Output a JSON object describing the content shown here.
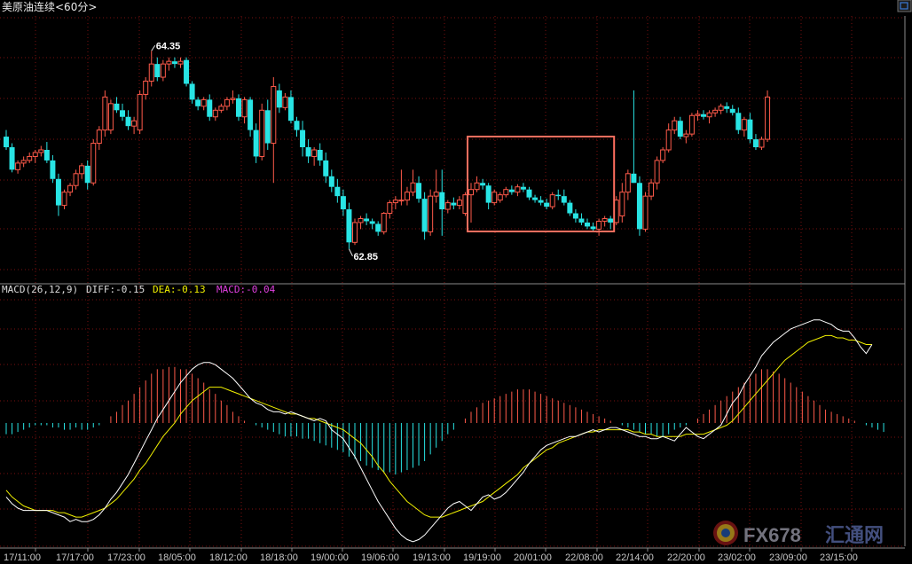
{
  "window": {
    "title": "美原油连续<60分>",
    "corner_icon": "window-restore-icon"
  },
  "colors": {
    "up": "#ff5a4a",
    "down": "#28e4e4",
    "grid": "#7a1010",
    "diff": "#ffffff",
    "dea": "#f0f000",
    "macd_label": "#e040e0",
    "highlight_box": "#ff6e5e",
    "axis_text": "#c8c8c8",
    "watermark": "#9a9aa8"
  },
  "indicator": {
    "name": "MACD(26,12,9)",
    "diff_label": "DIFF:-0.15",
    "dea_label": "DEA:-0.13",
    "macd_label": "MACD:-0.04"
  },
  "watermark": {
    "text": "FX678",
    "sub": "汇通网"
  },
  "chart_data": [
    {
      "type": "candlestick",
      "title": "美原油连续<60分>",
      "y_range": [
        62.6,
        64.6
      ],
      "annotations": [
        {
          "label": "64.35",
          "value": 64.35,
          "at_candle": 25
        },
        {
          "label": "62.85",
          "value": 62.85,
          "at_candle": 59
        }
      ],
      "highlight_box": {
        "from_candle": 80,
        "to_candle": 104
      },
      "x_tick_labels": [
        "17/11:00",
        "17/17:00",
        "17/23:00",
        "18/05:00",
        "18/12:00",
        "18/18:00",
        "19/00:00",
        "19/06:00",
        "19/13:00",
        "19/19:00",
        "20/01:00",
        "22/08:00",
        "22/14:00",
        "22/20:00",
        "23/02:00",
        "23/09:00",
        "23/15:00"
      ],
      "ohlc": [
        [
          63.7,
          63.75,
          63.6,
          63.62
        ],
        [
          63.62,
          63.65,
          63.43,
          63.45
        ],
        [
          63.45,
          63.52,
          63.42,
          63.5
        ],
        [
          63.5,
          63.55,
          63.47,
          63.52
        ],
        [
          63.52,
          63.58,
          63.5,
          63.55
        ],
        [
          63.55,
          63.6,
          63.5,
          63.58
        ],
        [
          63.58,
          63.63,
          63.55,
          63.6
        ],
        [
          63.6,
          63.66,
          63.5,
          63.52
        ],
        [
          63.52,
          63.56,
          63.35,
          63.38
        ],
        [
          63.38,
          63.42,
          63.1,
          63.18
        ],
        [
          63.18,
          63.3,
          63.15,
          63.28
        ],
        [
          63.28,
          63.35,
          63.25,
          63.33
        ],
        [
          63.33,
          63.45,
          63.3,
          63.42
        ],
        [
          63.42,
          63.5,
          63.38,
          63.48
        ],
        [
          63.48,
          63.52,
          63.3,
          63.35
        ],
        [
          63.35,
          63.68,
          63.33,
          63.65
        ],
        [
          63.65,
          63.78,
          63.6,
          63.75
        ],
        [
          63.75,
          64.05,
          63.7,
          64.0
        ],
        [
          63.75,
          63.98,
          63.72,
          63.95
        ],
        [
          63.95,
          64.0,
          63.88,
          63.9
        ],
        [
          63.9,
          63.95,
          63.82,
          63.85
        ],
        [
          63.85,
          63.9,
          63.75,
          63.78
        ],
        [
          63.78,
          63.85,
          63.72,
          63.82
        ],
        [
          63.75,
          64.05,
          63.72,
          64.02
        ],
        [
          64.02,
          64.15,
          63.98,
          64.12
        ],
        [
          64.12,
          64.35,
          64.08,
          64.25
        ],
        [
          64.25,
          64.3,
          64.12,
          64.15
        ],
        [
          64.15,
          64.28,
          64.12,
          64.25
        ],
        [
          64.25,
          64.3,
          64.2,
          64.27
        ],
        [
          64.27,
          64.3,
          64.22,
          64.25
        ],
        [
          64.25,
          64.3,
          64.22,
          64.27
        ],
        [
          64.28,
          64.3,
          64.08,
          64.1
        ],
        [
          64.1,
          64.12,
          63.95,
          63.98
        ],
        [
          63.98,
          64.0,
          63.9,
          63.93
        ],
        [
          63.93,
          64.0,
          63.9,
          63.98
        ],
        [
          63.98,
          64.02,
          63.82,
          63.85
        ],
        [
          63.85,
          63.92,
          63.82,
          63.9
        ],
        [
          63.9,
          63.95,
          63.88,
          63.93
        ],
        [
          63.93,
          64.0,
          63.9,
          63.98
        ],
        [
          63.98,
          64.05,
          63.95,
          63.99
        ],
        [
          63.99,
          64.02,
          63.82,
          63.85
        ],
        [
          63.85,
          64.0,
          63.8,
          63.98
        ],
        [
          63.98,
          64.0,
          63.7,
          63.75
        ],
        [
          63.75,
          63.8,
          63.5,
          63.55
        ],
        [
          63.55,
          63.95,
          63.52,
          63.9
        ],
        [
          63.9,
          63.98,
          63.6,
          63.65
        ],
        [
          63.65,
          64.15,
          63.35,
          64.08
        ],
        [
          64.05,
          64.1,
          63.88,
          63.92
        ],
        [
          63.92,
          64.03,
          63.9,
          64.0
        ],
        [
          64.0,
          64.05,
          63.8,
          63.82
        ],
        [
          63.82,
          63.85,
          63.7,
          63.75
        ],
        [
          63.75,
          63.82,
          63.55,
          63.62
        ],
        [
          63.62,
          63.68,
          63.5,
          63.55
        ],
        [
          63.55,
          63.62,
          63.48,
          63.6
        ],
        [
          63.6,
          63.65,
          63.48,
          63.52
        ],
        [
          63.52,
          63.58,
          63.35,
          63.4
        ],
        [
          63.4,
          63.45,
          63.28,
          63.32
        ],
        [
          63.32,
          63.38,
          63.2,
          63.25
        ],
        [
          63.25,
          63.3,
          63.1,
          63.15
        ],
        [
          63.15,
          63.2,
          62.85,
          62.9
        ],
        [
          62.9,
          63.08,
          62.88,
          63.05
        ],
        [
          63.05,
          63.1,
          63.0,
          63.08
        ],
        [
          63.08,
          63.12,
          63.03,
          63.06
        ],
        [
          63.06,
          63.08,
          63.0,
          63.04
        ],
        [
          63.04,
          63.06,
          62.95,
          62.98
        ],
        [
          62.98,
          63.13,
          62.96,
          63.12
        ],
        [
          63.12,
          63.22,
          63.08,
          63.2
        ],
        [
          63.2,
          63.25,
          63.15,
          63.22
        ],
        [
          63.22,
          63.45,
          63.18,
          63.22
        ],
        [
          63.22,
          63.32,
          63.18,
          63.28
        ],
        [
          63.28,
          63.45,
          63.25,
          63.35
        ],
        [
          63.35,
          63.4,
          63.2,
          63.23
        ],
        [
          63.23,
          63.28,
          62.92,
          62.98
        ],
        [
          62.98,
          63.3,
          62.95,
          63.25
        ],
        [
          63.25,
          63.45,
          63.2,
          63.28
        ],
        [
          63.28,
          63.45,
          62.95,
          63.15
        ],
        [
          63.15,
          63.22,
          63.12,
          63.2
        ],
        [
          63.2,
          63.24,
          63.15,
          63.18
        ],
        [
          63.18,
          63.25,
          63.15,
          63.22
        ],
        [
          63.12,
          63.28,
          63.1,
          63.26
        ],
        [
          63.26,
          63.35,
          63.05,
          63.3
        ],
        [
          63.3,
          63.4,
          63.28,
          63.35
        ],
        [
          63.35,
          63.38,
          63.3,
          63.33
        ],
        [
          63.33,
          63.35,
          63.15,
          63.2
        ],
        [
          63.2,
          63.3,
          63.18,
          63.28
        ],
        [
          63.22,
          63.28,
          63.2,
          63.26
        ],
        [
          63.26,
          63.32,
          63.24,
          63.3
        ],
        [
          63.3,
          63.33,
          63.26,
          63.28
        ],
        [
          63.28,
          63.34,
          63.25,
          63.32
        ],
        [
          63.32,
          63.35,
          63.28,
          63.3
        ],
        [
          63.3,
          63.32,
          63.22,
          63.24
        ],
        [
          63.24,
          63.26,
          63.2,
          63.22
        ],
        [
          63.22,
          63.25,
          63.18,
          63.2
        ],
        [
          63.2,
          63.23,
          63.15,
          63.17
        ],
        [
          63.17,
          63.28,
          63.15,
          63.26
        ],
        [
          63.26,
          63.3,
          63.22,
          63.25
        ],
        [
          63.25,
          63.3,
          63.18,
          63.2
        ],
        [
          63.2,
          63.22,
          63.1,
          63.12
        ],
        [
          63.12,
          63.15,
          63.05,
          63.08
        ],
        [
          63.08,
          63.12,
          63.03,
          63.05
        ],
        [
          63.05,
          63.08,
          63.0,
          63.02
        ],
        [
          63.02,
          63.05,
          62.98,
          63.0
        ],
        [
          63.0,
          63.08,
          62.95,
          63.06
        ],
        [
          63.06,
          63.1,
          63.02,
          63.08
        ],
        [
          63.08,
          63.1,
          63.0,
          63.05
        ],
        [
          63.05,
          63.25,
          63.03,
          63.22
        ],
        [
          63.1,
          63.35,
          63.05,
          63.28
        ],
        [
          63.28,
          63.45,
          63.22,
          63.42
        ],
        [
          63.42,
          64.05,
          63.35,
          63.35
        ],
        [
          63.35,
          63.4,
          62.95,
          63.0
        ],
        [
          63.0,
          63.28,
          62.98,
          63.25
        ],
        [
          63.25,
          63.38,
          63.22,
          63.35
        ],
        [
          63.35,
          63.55,
          63.3,
          63.52
        ],
        [
          63.52,
          63.62,
          63.5,
          63.6
        ],
        [
          63.6,
          63.8,
          63.58,
          63.75
        ],
        [
          63.75,
          63.85,
          63.72,
          63.82
        ],
        [
          63.82,
          63.85,
          63.68,
          63.7
        ],
        [
          63.7,
          63.75,
          63.65,
          63.72
        ],
        [
          63.72,
          63.88,
          63.7,
          63.86
        ],
        [
          63.86,
          63.9,
          63.82,
          63.87
        ],
        [
          63.87,
          63.9,
          63.83,
          63.85
        ],
        [
          63.85,
          63.9,
          63.8,
          63.88
        ],
        [
          63.88,
          63.92,
          63.85,
          63.9
        ],
        [
          63.9,
          63.95,
          63.87,
          63.93
        ],
        [
          63.93,
          63.96,
          63.88,
          63.91
        ],
        [
          63.91,
          63.94,
          63.86,
          63.88
        ],
        [
          63.88,
          63.92,
          63.72,
          63.75
        ],
        [
          63.75,
          63.85,
          63.7,
          63.83
        ],
        [
          63.83,
          63.88,
          63.65,
          63.68
        ],
        [
          63.68,
          63.72,
          63.6,
          63.62
        ],
        [
          63.62,
          63.7,
          63.6,
          63.68
        ],
        [
          63.68,
          64.05,
          63.66,
          64.0
        ]
      ]
    },
    {
      "type": "bar",
      "title": "MACD(26,12,9)",
      "y_range": [
        -0.55,
        0.55
      ],
      "series": [
        {
          "name": "DIFF",
          "kind": "line"
        },
        {
          "name": "DEA",
          "kind": "line"
        },
        {
          "name": "MACD",
          "kind": "histogram"
        }
      ],
      "diff": [
        -0.33,
        -0.36,
        -0.38,
        -0.39,
        -0.39,
        -0.39,
        -0.39,
        -0.39,
        -0.4,
        -0.41,
        -0.42,
        -0.44,
        -0.43,
        -0.44,
        -0.44,
        -0.43,
        -0.41,
        -0.38,
        -0.34,
        -0.31,
        -0.27,
        -0.23,
        -0.18,
        -0.13,
        -0.08,
        -0.03,
        0.02,
        0.06,
        0.1,
        0.14,
        0.18,
        0.21,
        0.24,
        0.26,
        0.27,
        0.27,
        0.26,
        0.24,
        0.22,
        0.2,
        0.17,
        0.14,
        0.11,
        0.09,
        0.08,
        0.06,
        0.05,
        0.05,
        0.04,
        0.05,
        0.04,
        0.03,
        0.02,
        0.01,
        0.02,
        0.01,
        -0.03,
        -0.05,
        -0.07,
        -0.11,
        -0.15,
        -0.2,
        -0.25,
        -0.3,
        -0.35,
        -0.39,
        -0.43,
        -0.47,
        -0.5,
        -0.52,
        -0.53,
        -0.52,
        -0.5,
        -0.47,
        -0.44,
        -0.41,
        -0.38,
        -0.36,
        -0.35,
        -0.37,
        -0.39,
        -0.36,
        -0.33,
        -0.32,
        -0.34,
        -0.33,
        -0.31,
        -0.28,
        -0.25,
        -0.22,
        -0.18,
        -0.15,
        -0.12,
        -0.1,
        -0.09,
        -0.08,
        -0.07,
        -0.06,
        -0.06,
        -0.05,
        -0.04,
        -0.03,
        -0.04,
        -0.03,
        -0.02,
        -0.02,
        -0.03,
        -0.04,
        -0.05,
        -0.06,
        -0.06,
        -0.07,
        -0.07,
        -0.06,
        -0.07,
        -0.08,
        -0.05,
        -0.02,
        -0.04,
        -0.06,
        -0.07,
        -0.05,
        -0.03,
        -0.01,
        0.04,
        0.09,
        0.12,
        0.17,
        0.21,
        0.25,
        0.3,
        0.33,
        0.36,
        0.38,
        0.4,
        0.42,
        0.43,
        0.44,
        0.45,
        0.46,
        0.46,
        0.45,
        0.44,
        0.42,
        0.41,
        0.41,
        0.38,
        0.34,
        0.31,
        0.35
      ],
      "dea": [
        -0.3,
        -0.33,
        -0.35,
        -0.37,
        -0.38,
        -0.39,
        -0.39,
        -0.39,
        -0.39,
        -0.4,
        -0.4,
        -0.41,
        -0.42,
        -0.42,
        -0.41,
        -0.4,
        -0.39,
        -0.38,
        -0.36,
        -0.34,
        -0.31,
        -0.28,
        -0.25,
        -0.21,
        -0.18,
        -0.14,
        -0.1,
        -0.06,
        -0.03,
        0.0,
        0.04,
        0.07,
        0.1,
        0.12,
        0.14,
        0.16,
        0.16,
        0.16,
        0.15,
        0.14,
        0.13,
        0.12,
        0.11,
        0.1,
        0.09,
        0.08,
        0.07,
        0.06,
        0.05,
        0.04,
        0.04,
        0.03,
        0.02,
        0.02,
        0.01,
        0.0,
        -0.01,
        -0.02,
        -0.03,
        -0.05,
        -0.07,
        -0.09,
        -0.12,
        -0.15,
        -0.19,
        -0.22,
        -0.26,
        -0.29,
        -0.32,
        -0.35,
        -0.37,
        -0.39,
        -0.41,
        -0.42,
        -0.42,
        -0.42,
        -0.41,
        -0.4,
        -0.39,
        -0.38,
        -0.37,
        -0.36,
        -0.35,
        -0.33,
        -0.31,
        -0.29,
        -0.27,
        -0.25,
        -0.23,
        -0.2,
        -0.18,
        -0.16,
        -0.14,
        -0.12,
        -0.11,
        -0.09,
        -0.08,
        -0.07,
        -0.06,
        -0.05,
        -0.04,
        -0.04,
        -0.03,
        -0.03,
        -0.03,
        -0.03,
        -0.03,
        -0.03,
        -0.04,
        -0.04,
        -0.05,
        -0.05,
        -0.06,
        -0.06,
        -0.06,
        -0.06,
        -0.06,
        -0.05,
        -0.05,
        -0.05,
        -0.05,
        -0.04,
        -0.03,
        -0.02,
        -0.01,
        0.01,
        0.04,
        0.07,
        0.1,
        0.13,
        0.16,
        0.19,
        0.22,
        0.25,
        0.28,
        0.3,
        0.32,
        0.34,
        0.36,
        0.37,
        0.38,
        0.39,
        0.39,
        0.38,
        0.38,
        0.37,
        0.37,
        0.36,
        0.35,
        0.35
      ],
      "macd": [
        -0.05,
        -0.05,
        -0.04,
        -0.03,
        -0.02,
        -0.01,
        -0.01,
        -0.01,
        -0.02,
        -0.02,
        -0.03,
        -0.03,
        -0.02,
        -0.03,
        -0.03,
        -0.02,
        -0.01,
        0.0,
        0.03,
        0.05,
        0.08,
        0.1,
        0.13,
        0.16,
        0.19,
        0.22,
        0.24,
        0.24,
        0.25,
        0.25,
        0.24,
        0.24,
        0.22,
        0.2,
        0.18,
        0.15,
        0.13,
        0.1,
        0.08,
        0.05,
        0.03,
        0.01,
        0.0,
        -0.01,
        -0.02,
        -0.03,
        -0.04,
        -0.05,
        -0.06,
        -0.06,
        -0.06,
        -0.07,
        -0.07,
        -0.08,
        -0.09,
        -0.1,
        -0.11,
        -0.12,
        -0.13,
        -0.15,
        -0.16,
        -0.17,
        -0.19,
        -0.2,
        -0.21,
        -0.22,
        -0.22,
        -0.23,
        -0.22,
        -0.21,
        -0.2,
        -0.19,
        -0.17,
        -0.14,
        -0.11,
        -0.08,
        -0.05,
        -0.03,
        0.0,
        0.02,
        0.05,
        0.07,
        0.09,
        0.1,
        0.11,
        0.12,
        0.13,
        0.14,
        0.15,
        0.15,
        0.15,
        0.14,
        0.13,
        0.12,
        0.11,
        0.1,
        0.09,
        0.08,
        0.07,
        0.06,
        0.05,
        0.04,
        0.03,
        0.02,
        0.01,
        0.0,
        -0.01,
        -0.02,
        -0.03,
        -0.04,
        -0.05,
        -0.05,
        -0.06,
        -0.06,
        -0.05,
        -0.03,
        -0.02,
        -0.01,
        0.0,
        0.02,
        0.04,
        0.06,
        0.08,
        0.1,
        0.12,
        0.14,
        0.16,
        0.18,
        0.2,
        0.22,
        0.24,
        0.24,
        0.23,
        0.22,
        0.2,
        0.18,
        0.16,
        0.14,
        0.12,
        0.1,
        0.08,
        0.06,
        0.05,
        0.04,
        0.03,
        0.02,
        0.01,
        0.0,
        -0.01,
        -0.02,
        -0.03,
        -0.04
      ]
    }
  ]
}
